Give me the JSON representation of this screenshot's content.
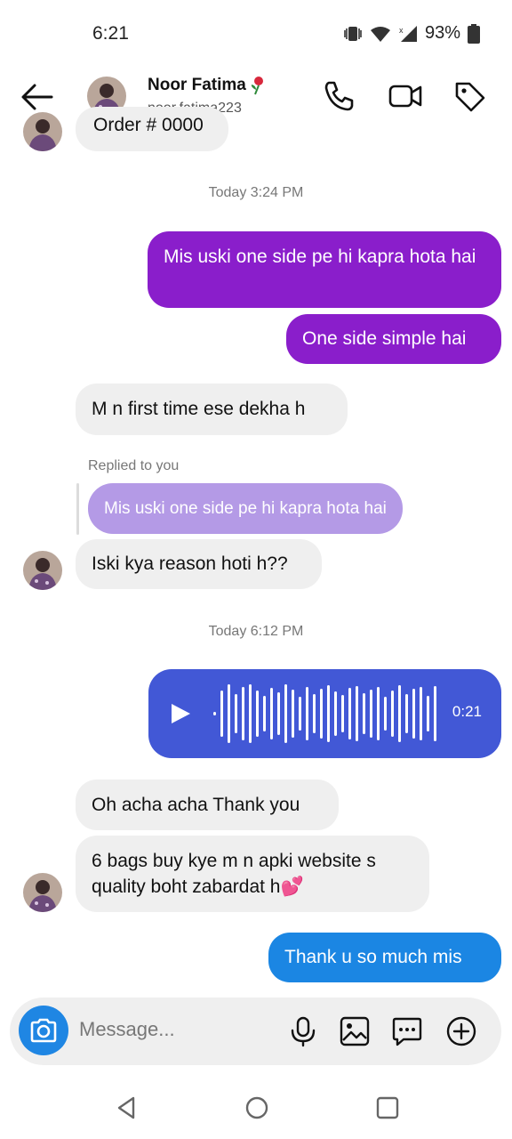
{
  "status": {
    "time": "6:21",
    "battery": "93%"
  },
  "header": {
    "name": "Noor Fatima",
    "username": "noor.fatima223"
  },
  "timestamps": [
    "Today 3:24 PM",
    "Today 6:12 PM"
  ],
  "messages": {
    "partial": "Order # 0000",
    "out1": "Mis uski one side pe hi kapra hota hai",
    "out2": "One side simple hai",
    "in1": "M n first time ese dekha h",
    "replied_label": "Replied to you",
    "quoted": "Mis uski one side pe hi kapra hota hai",
    "in2": "Iski kya reason hoti h??",
    "voice_duration": "0:21",
    "in3": "Oh acha acha Thank you",
    "in4": "6 bags buy kye m n apki website s quality boht zabardat h💕",
    "out3": "Thank u so much mis"
  },
  "composer": {
    "placeholder": "Message..."
  },
  "colors": {
    "purple": "#8a1ecb",
    "voice": "#4258d6",
    "blue": "#1b86e3",
    "quoted": "#b49ae6"
  }
}
